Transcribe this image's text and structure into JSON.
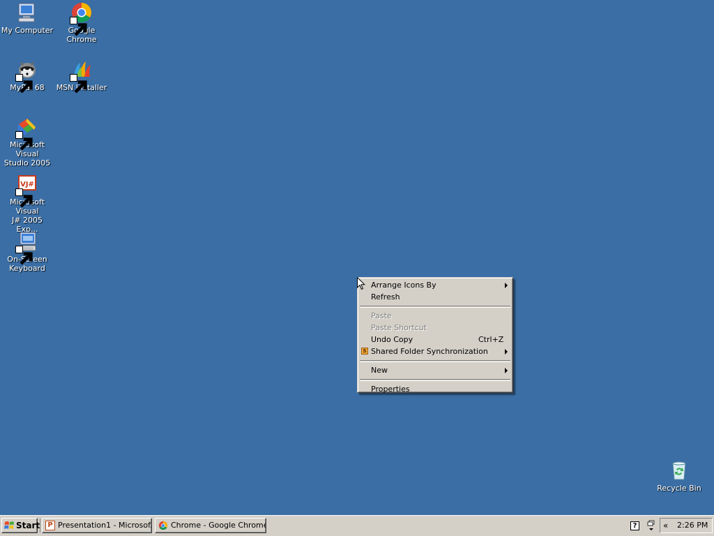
{
  "desktop": {
    "background_color": "#3a6ea5",
    "icons": [
      {
        "label": "My Computer",
        "icon": "my-computer-icon"
      },
      {
        "label": "Google Chrome",
        "icon": "chrome-icon"
      },
      {
        "label": "MyPal 68",
        "icon": "mypal-icon"
      },
      {
        "label": "MSN Installer",
        "icon": "msn-icon"
      },
      {
        "label_line1": "Microsoft Visual",
        "label_line2": "Studio 2005",
        "icon": "visual-studio-icon"
      },
      {
        "label_line1": "Microsoft Visual",
        "label_line2": "J# 2005 Exp...",
        "icon": "vjsharp-icon",
        "glyph_text": "VJ#"
      },
      {
        "label_line1": "On-Screen",
        "label_line2": "Keyboard",
        "icon": "keyboard-icon"
      },
      {
        "label": "Recycle Bin",
        "icon": "recycle-bin-icon"
      }
    ]
  },
  "context_menu": {
    "items": [
      {
        "label": "Arrange Icons By",
        "submenu": true
      },
      {
        "label": "Refresh"
      },
      {
        "label": "Paste",
        "disabled": true
      },
      {
        "label": "Paste Shortcut",
        "disabled": true
      },
      {
        "label": "Undo Copy",
        "shortcut": "Ctrl+Z"
      },
      {
        "label": "Shared Folder Synchronization",
        "submenu": true,
        "icon_text": "S"
      },
      {
        "label": "New",
        "submenu": true
      },
      {
        "label": "Properties"
      }
    ]
  },
  "taskbar": {
    "start_label": "Start",
    "tasks": [
      {
        "label": "Presentation1 - Microsof...",
        "icon": "powerpoint-icon",
        "glyph": "P"
      },
      {
        "label": "Chrome - Google Chrome",
        "icon": "chrome-icon"
      }
    ],
    "help_glyph": "?",
    "tray_chevron": "«",
    "clock": "2:26 PM"
  }
}
